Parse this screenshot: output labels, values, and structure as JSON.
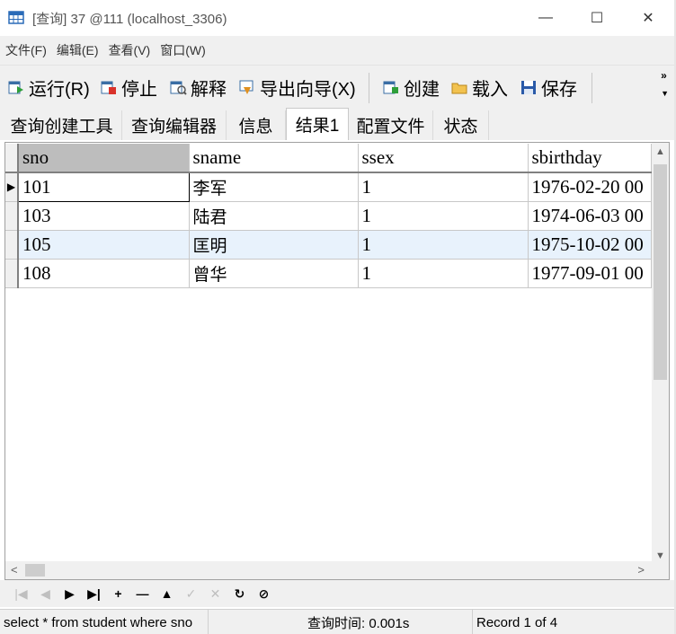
{
  "window": {
    "title": "[查询] 37 @111 (localhost_3306)",
    "minimize_label": "—",
    "maximize_label": "☐",
    "close_label": "✕"
  },
  "menu": [
    "文件(F)",
    "编辑(E)",
    "查看(V)",
    "窗口(W)"
  ],
  "toolbar": {
    "run": "运行(R)",
    "stop": "停止",
    "explain": "解释",
    "export_wizard": "导出向导(X)",
    "create": "创建",
    "load": "载入",
    "save": "保存",
    "overflow": "»"
  },
  "tabs": [
    "查询创建工具",
    "查询编辑器",
    "信息",
    "结果1",
    "配置文件",
    "状态"
  ],
  "active_tab": "结果1",
  "grid": {
    "columns": [
      "sno",
      "sname",
      "ssex",
      "sbirthday"
    ],
    "rows": [
      [
        "101",
        "李军",
        "1",
        "1976-02-20 00"
      ],
      [
        "103",
        "陆君",
        "1",
        "1974-06-03 00"
      ],
      [
        "105",
        "匡明",
        "1",
        "1975-10-02 00"
      ],
      [
        "108",
        "曾华",
        "1",
        "1977-09-01 00"
      ]
    ],
    "current_row_marker": "▶"
  },
  "navigator": [
    "|◀",
    "◀",
    "▶",
    "▶|",
    "+",
    "—",
    "▲",
    "✓",
    "✕",
    "↻",
    "⊘"
  ],
  "status": {
    "sql": "select * from student where sno",
    "query_time": "查询时间: 0.001s",
    "record": "Record 1 of 4"
  },
  "colors": {
    "chrome": "#f0f0f0",
    "selected_row": "#e8f2fc",
    "sorted_header": "#bdbdbd"
  }
}
